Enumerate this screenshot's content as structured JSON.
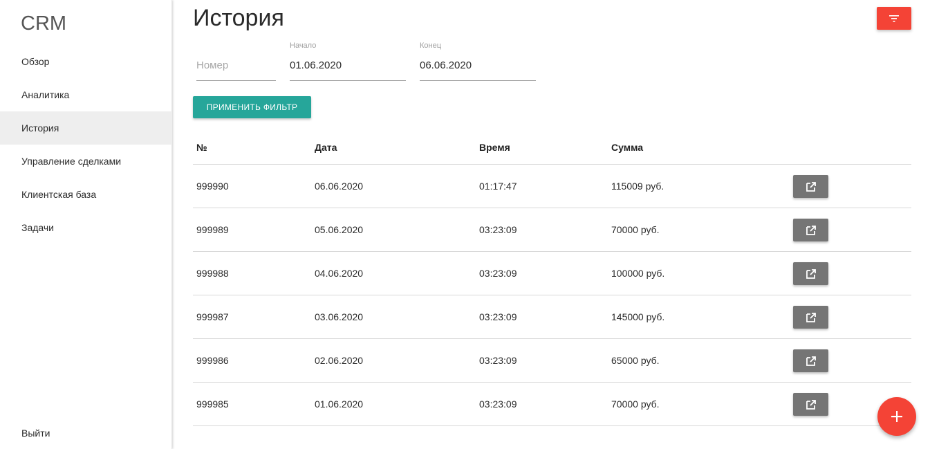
{
  "sidebar": {
    "brand": "CRM",
    "items": [
      {
        "label": "Обзор"
      },
      {
        "label": "Аналитика"
      },
      {
        "label": "История"
      },
      {
        "label": "Управление сделками"
      },
      {
        "label": "Клиентская база"
      },
      {
        "label": "Задачи"
      }
    ],
    "active_index": 2,
    "logout_label": "Выйти"
  },
  "page": {
    "title": "История"
  },
  "filters": {
    "number": {
      "label": "",
      "placeholder": "Номер",
      "value": ""
    },
    "start": {
      "label": "Начало",
      "value": "01.06.2020"
    },
    "end": {
      "label": "Конец",
      "value": "06.06.2020"
    },
    "apply_label": "Применить фильтр"
  },
  "table": {
    "headers": [
      "№",
      "Дата",
      "Время",
      "Сумма"
    ],
    "rows": [
      {
        "number": "999990",
        "date": "06.06.2020",
        "time": "01:17:47",
        "sum": "115009 руб."
      },
      {
        "number": "999989",
        "date": "05.06.2020",
        "time": "03:23:09",
        "sum": "70000 руб."
      },
      {
        "number": "999988",
        "date": "04.06.2020",
        "time": "03:23:09",
        "sum": "100000 руб."
      },
      {
        "number": "999987",
        "date": "03.06.2020",
        "time": "03:23:09",
        "sum": "145000 руб."
      },
      {
        "number": "999986",
        "date": "02.06.2020",
        "time": "03:23:09",
        "sum": "65000 руб."
      },
      {
        "number": "999985",
        "date": "01.06.2020",
        "time": "03:23:09",
        "sum": "70000 руб."
      }
    ]
  },
  "icons": {
    "filter": "filter-list-icon",
    "open": "open-in-new-icon",
    "add": "add-icon"
  },
  "colors": {
    "accent_red": "#f44336",
    "teal": "#26a69a",
    "grey_button": "#757575"
  }
}
